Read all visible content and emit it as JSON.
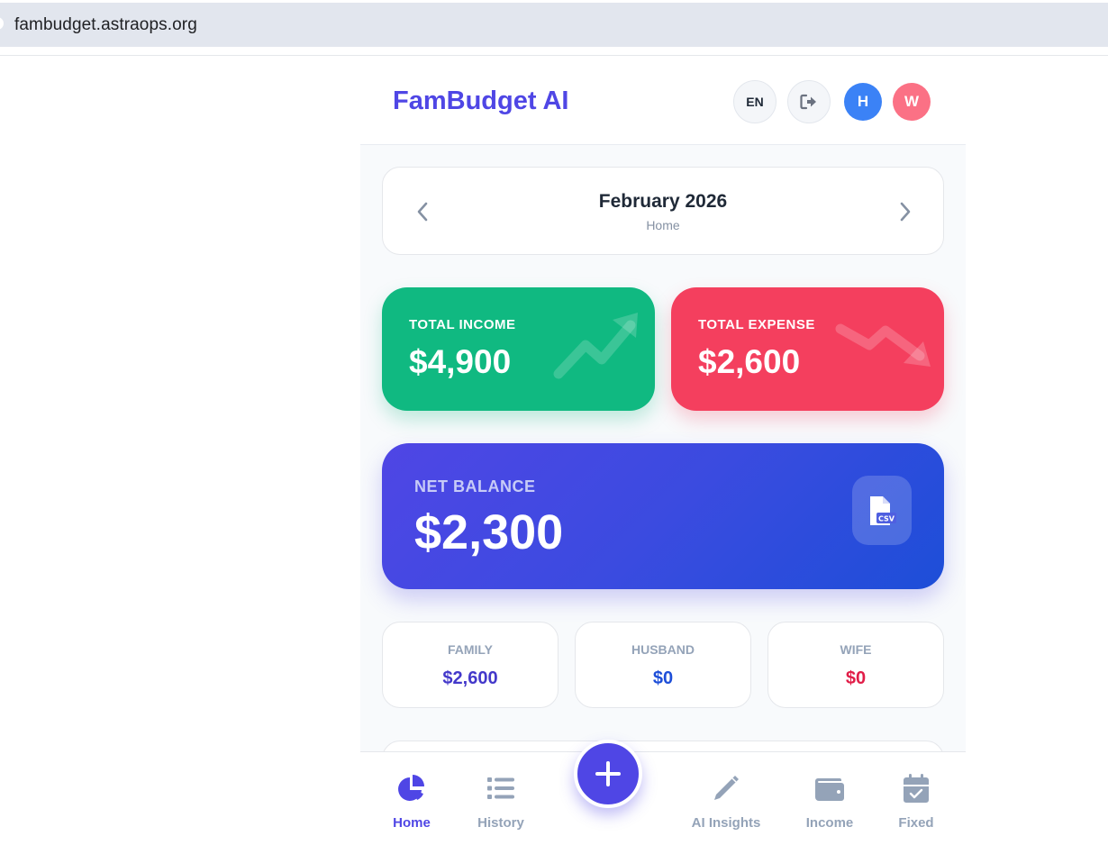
{
  "browser": {
    "url": "fambudget.astraops.org"
  },
  "header": {
    "brand": "FamBudget AI",
    "lang_label": "EN",
    "avatars": [
      {
        "initial": "H",
        "color": "#3b82f6"
      },
      {
        "initial": "W",
        "color": "#fb7185"
      }
    ]
  },
  "month_selector": {
    "title": "February 2026",
    "subtitle": "Home"
  },
  "summary": {
    "income": {
      "label": "TOTAL INCOME",
      "value": "$4,900",
      "color": "#10b981"
    },
    "expense": {
      "label": "TOTAL EXPENSE",
      "value": "$2,600",
      "color": "#f43f5e"
    },
    "net": {
      "label": "NET BALANCE",
      "value": "$2,300",
      "export_icon": "csv-file-icon"
    }
  },
  "breakdown": [
    {
      "label": "FAMILY",
      "value": "$2,600",
      "color": "#4338ca"
    },
    {
      "label": "HUSBAND",
      "value": "$0",
      "color": "#1d4ed8"
    },
    {
      "label": "WIFE",
      "value": "$0",
      "color": "#e11d48"
    }
  ],
  "nav": {
    "items": [
      {
        "label": "Home",
        "icon": "pie-chart-icon",
        "active": true
      },
      {
        "label": "History",
        "icon": "list-icon",
        "active": false
      },
      {
        "label": "AI Insights",
        "icon": "pencil-icon",
        "active": false
      },
      {
        "label": "Income",
        "icon": "wallet-icon",
        "active": false
      },
      {
        "label": "Fixed",
        "icon": "calendar-check-icon",
        "active": false
      }
    ],
    "fab_icon": "plus-icon"
  },
  "colors": {
    "accent": "#4f46e5",
    "muted": "#94a3b8"
  }
}
